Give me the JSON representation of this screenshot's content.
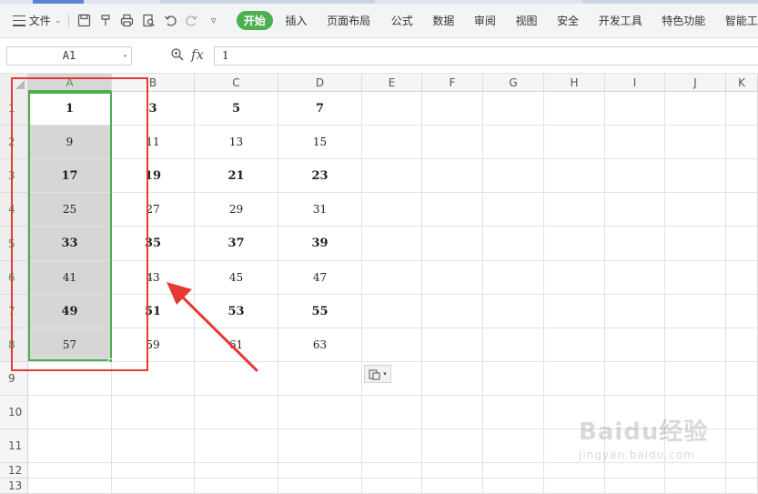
{
  "toolbar": {
    "file_label": "文件",
    "tabs": [
      "开始",
      "插入",
      "页面布局",
      "公式",
      "数据",
      "审阅",
      "视图",
      "安全",
      "开发工具",
      "特色功能",
      "智能工"
    ],
    "active_tab": "开始",
    "accent_color": "#4caf50"
  },
  "formula_bar": {
    "name_box": "A1",
    "fx_label": "fx",
    "value": "1"
  },
  "grid": {
    "columns": [
      "A",
      "B",
      "C",
      "D",
      "E",
      "F",
      "G",
      "H",
      "I",
      "J",
      "K"
    ],
    "rows": [
      "1",
      "2",
      "3",
      "4",
      "5",
      "6",
      "7",
      "8",
      "9",
      "10",
      "11",
      "12",
      "13"
    ],
    "cells": {
      "A": [
        "1",
        "9",
        "17",
        "25",
        "33",
        "41",
        "49",
        "57"
      ],
      "B": [
        "3",
        "11",
        "19",
        "27",
        "35",
        "43",
        "51",
        "59"
      ],
      "C": [
        "5",
        "13",
        "21",
        "29",
        "37",
        "45",
        "53",
        "61"
      ],
      "D": [
        "7",
        "15",
        "23",
        "31",
        "39",
        "47",
        "55",
        "63"
      ]
    },
    "bold_rows": [
      1,
      3,
      5,
      7
    ],
    "selected_range": "A1:A8",
    "selection_color": "#4caf50"
  },
  "annotation": {
    "box_color": "#e53935",
    "arrow_color": "#e53935"
  },
  "paste_options_icon": "paste-options-icon",
  "watermark": {
    "main": "Baidu经验",
    "sub": "jingyan.baidu.com"
  }
}
